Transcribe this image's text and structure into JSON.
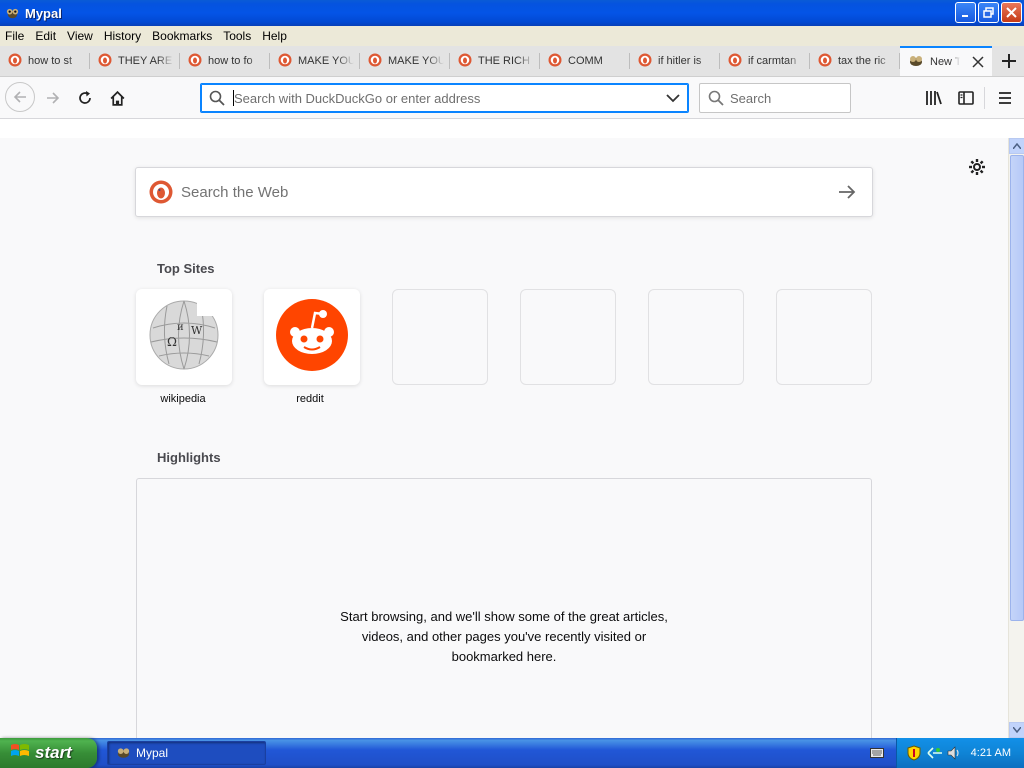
{
  "window": {
    "title": "Mypal",
    "icon": "mypal-icon"
  },
  "menu": [
    "File",
    "Edit",
    "View",
    "History",
    "Bookmarks",
    "Tools",
    "Help"
  ],
  "tabs": [
    {
      "label": "how to st",
      "icon": "duckduckgo-icon"
    },
    {
      "label": "THEY ARE",
      "icon": "duckduckgo-icon"
    },
    {
      "label": "how to fo",
      "icon": "duckduckgo-icon"
    },
    {
      "label": "MAKE YOU",
      "icon": "duckduckgo-icon"
    },
    {
      "label": "MAKE YOU",
      "icon": "duckduckgo-icon"
    },
    {
      "label": "THE RICH",
      "icon": "duckduckgo-icon"
    },
    {
      "label": "COMM",
      "icon": "duckduckgo-icon"
    },
    {
      "label": "if hitler is",
      "icon": "duckduckgo-icon"
    },
    {
      "label": "if carmtan",
      "icon": "duckduckgo-icon"
    },
    {
      "label": "tax the ric",
      "icon": "duckduckgo-icon"
    },
    {
      "label": "New T",
      "icon": "mypal-icon",
      "active": true
    }
  ],
  "toolbar": {
    "url_placeholder": "Search with DuckDuckGo or enter address",
    "search_placeholder": "Search"
  },
  "newtab": {
    "search_placeholder": "Search the Web",
    "top_sites_title": "Top Sites",
    "top_sites": [
      {
        "label": "wikipedia",
        "icon": "wikipedia-icon"
      },
      {
        "label": "reddit",
        "icon": "reddit-icon"
      }
    ],
    "highlights_title": "Highlights",
    "highlights_message": [
      "Start browsing, and we'll show some of the great articles,",
      "videos, and other pages you've recently visited or",
      "bookmarked here."
    ]
  },
  "taskbar": {
    "start_label": "start",
    "task_label": "Mypal",
    "clock": "4:21 AM"
  },
  "colors": {
    "accent": "#0a84ff",
    "reddit": "#ff4500",
    "duckduckgo": "#de5833"
  }
}
